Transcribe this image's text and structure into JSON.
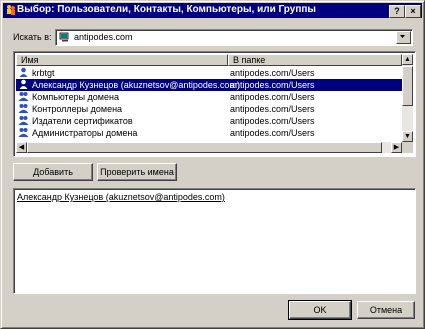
{
  "window": {
    "title": "Выбор: Пользователи, Контакты, Компьютеры, или Группы",
    "help_button": "?",
    "close_button": "×"
  },
  "search": {
    "label": "Искать в:",
    "value": "antipodes.com"
  },
  "list": {
    "columns": [
      "Имя",
      "В папке"
    ],
    "rows": [
      {
        "name": "krbtgt",
        "folder": "antipodes.com/Users",
        "icon": "user-icon",
        "selected": false
      },
      {
        "name": "Александр Кузнецов (akuznetsov@antipodes.com)",
        "folder": "antipodes.com/Users",
        "icon": "user-icon",
        "selected": true
      },
      {
        "name": "Компьютеры домена",
        "folder": "antipodes.com/Users",
        "icon": "group-icon",
        "selected": false
      },
      {
        "name": "Контроллеры домена",
        "folder": "antipodes.com/Users",
        "icon": "group-icon",
        "selected": false
      },
      {
        "name": "Издатели сертификатов",
        "folder": "antipodes.com/Users",
        "icon": "group-icon",
        "selected": false
      },
      {
        "name": "Администраторы домена",
        "folder": "antipodes.com/Users",
        "icon": "group-icon",
        "selected": false
      }
    ]
  },
  "actions": {
    "add": "Добавить",
    "check_names": "Проверить имена"
  },
  "selected_names": {
    "text": "Александр Кузнецов (akuznetsov@antipodes.com)"
  },
  "footer": {
    "ok": "OK",
    "cancel": "Отмена"
  },
  "colors": {
    "titlebar": "#000080",
    "selection": "#000080",
    "face": "#d4d0c8"
  }
}
